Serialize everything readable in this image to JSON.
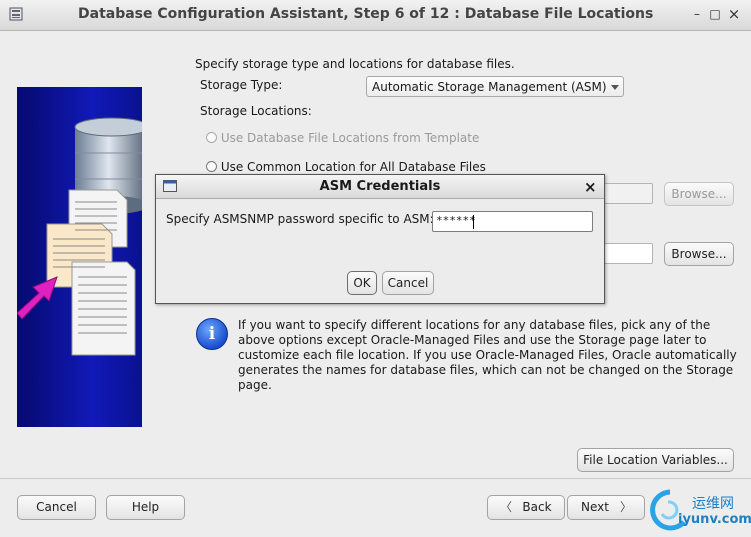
{
  "window": {
    "title": "Database Configuration Assistant, Step 6 of 12 : Database File Locations",
    "controls": {
      "minimize": "–",
      "maximize": "□",
      "close": "×"
    }
  },
  "main": {
    "intro": "Specify storage type and locations for database files.",
    "storage_type_label": "Storage Type:",
    "storage_type_value": "Automatic Storage Management (ASM)",
    "storage_locations_label": "Storage Locations:",
    "radio_template": "Use Database File Locations from Template",
    "radio_common": "Use Common Location for All Database Files",
    "browse_label": "Browse...",
    "info_text": "If you want to specify different locations for any database files, pick any of the above options except Oracle-Managed Files and use the Storage page later to customize each file location. If you use Oracle-Managed Files, Oracle automatically generates the names for database files, which can not be changed on the Storage page.",
    "file_location_variables": "File Location Variables..."
  },
  "dialog": {
    "title": "ASM Credentials",
    "close": "×",
    "prompt": "Specify ASMSNMP password specific to ASM:",
    "password_value": "******",
    "ok": "OK",
    "cancel": "Cancel"
  },
  "footer": {
    "cancel": "Cancel",
    "help": "Help",
    "back": "Back",
    "next": "Next"
  },
  "watermark": {
    "line1": "运维网",
    "line2": "iyunv.com"
  },
  "colors": {
    "art_bg": "#0a12a0",
    "info_icon": "#1a4fcf",
    "arrow": "#e020c0"
  }
}
